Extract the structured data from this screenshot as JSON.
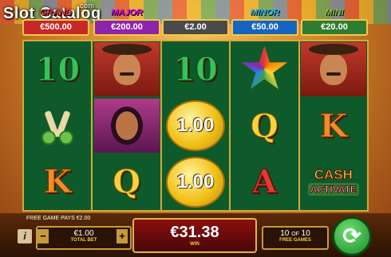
{
  "brand": {
    "logo": "Slot Catalog",
    "logo_suffix": "com"
  },
  "jackpots": [
    {
      "name": "GRAND",
      "value": "€500.00"
    },
    {
      "name": "MAJOR",
      "value": "€200.00"
    },
    {
      "name": "",
      "value": "€2.00"
    },
    {
      "name": "MINOR",
      "value": "€50.00"
    },
    {
      "name": "MINI",
      "value": "€20.00"
    }
  ],
  "reels": [
    [
      "10",
      "LIMES",
      "K"
    ],
    [
      "MARIACHI",
      "SENORITA",
      "Q"
    ],
    [
      "10",
      "1.00",
      "1.00"
    ],
    [
      "PINATA",
      "Q",
      "A"
    ],
    [
      "MARIACHI",
      "K",
      "CASH ACTIVATE"
    ]
  ],
  "symbols": {
    "cash": "CASH",
    "activate": "ACTIVATE"
  },
  "footer": {
    "free_game_pays": "FREE GAME PAYS €2.00",
    "info_label": "i",
    "bet_value": "€1.00",
    "bet_label": "TOTAL BET",
    "minus": "−",
    "plus": "+",
    "win_value": "€31.38",
    "win_label": "WIN",
    "free_games_current": "10",
    "free_games_of": "OF",
    "free_games_total": "10",
    "free_games_label": "FREE GAMES",
    "spin_symbol": "⟳"
  },
  "colors": {
    "reel_bg": "#0f5a2a",
    "frame_gold": "#d4a93a",
    "win_red": "#8b0f0f",
    "spin_green": "#1b8a2a"
  }
}
